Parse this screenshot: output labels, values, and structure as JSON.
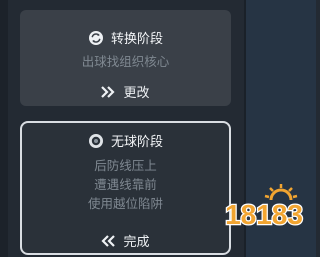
{
  "cards": [
    {
      "title": "转换阶段",
      "icon": "swap-cycle-icon",
      "lines": [
        "出球找组织核心"
      ],
      "action_label": "更改",
      "action_icon": "double-chevron-right-icon"
    },
    {
      "title": "无球阶段",
      "icon": "ring-icon",
      "lines": [
        "后防线压上",
        "遭遇线靠前",
        "使用越位陷阱"
      ],
      "action_label": "完成",
      "action_icon": "double-chevron-left-icon"
    }
  ],
  "watermark": {
    "text": "18183",
    "color": "#f2a531"
  },
  "colors": {
    "background": "#232a33",
    "card_top": "#3a4048",
    "card_bottom": "#2a3139",
    "desc_text": "#7f8891"
  }
}
